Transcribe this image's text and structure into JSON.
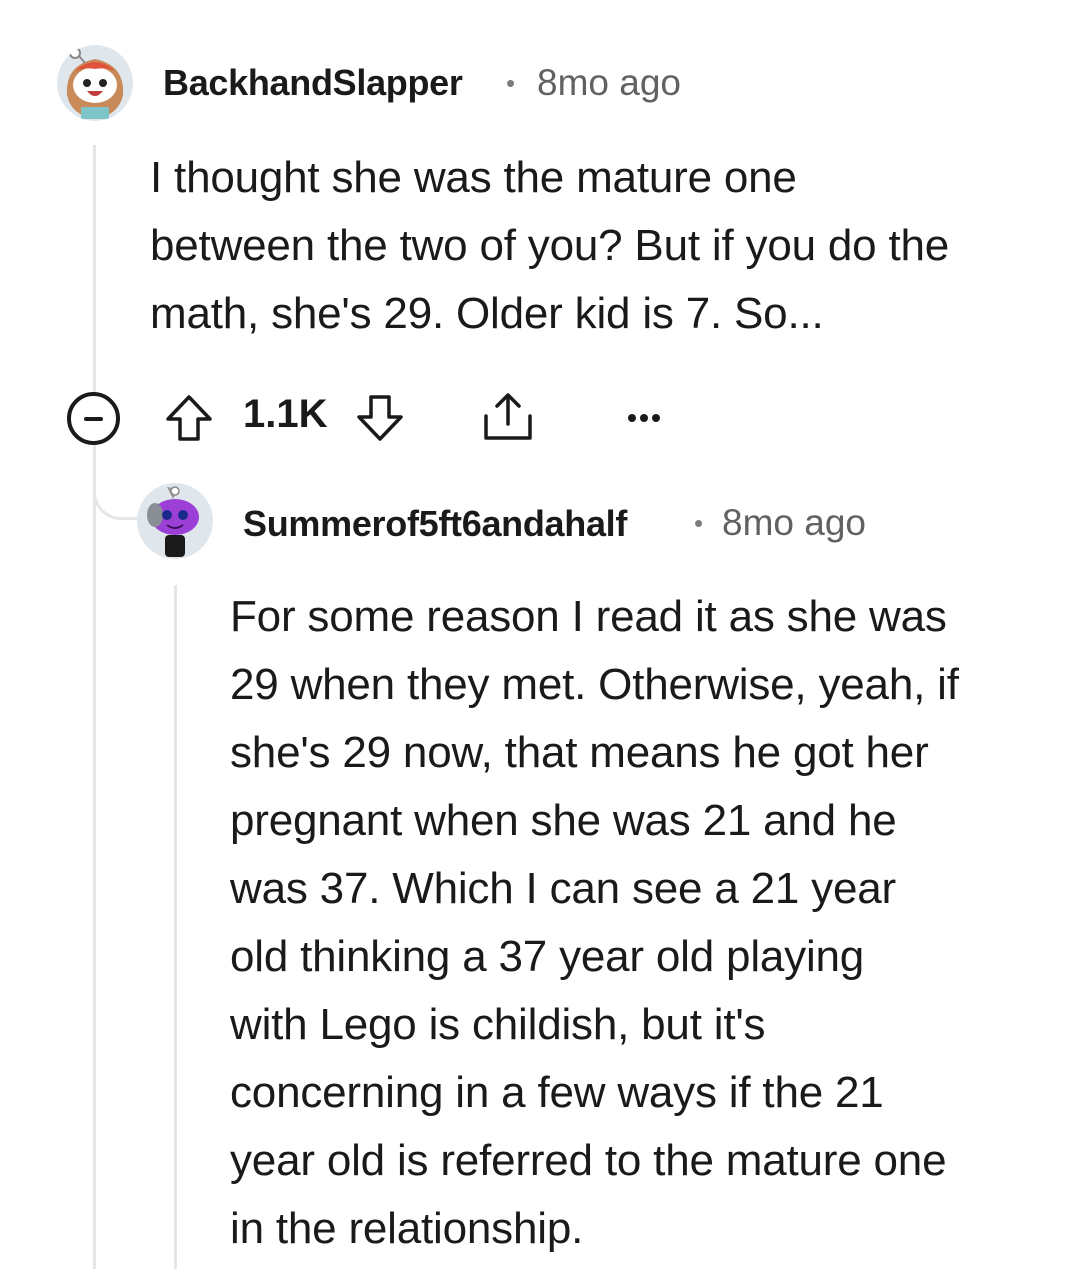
{
  "comments": [
    {
      "username": "BackhandSlapper",
      "separator": "•",
      "timestamp": "8mo ago",
      "avatar_icon": "snoo-avatar-icon",
      "body_lines": [
        "I thought she was the mature one",
        "between the two of you? But if you do the",
        "math, she's 29. Older kid is 7. So..."
      ],
      "actions": {
        "score": "1.1K",
        "collapse_icon": "collapse-icon",
        "upvote_icon": "upvote-arrow-icon",
        "downvote_icon": "downvote-arrow-icon",
        "share_icon": "share-icon",
        "more_icon": "more-options-icon"
      }
    },
    {
      "username": "Summerof5ft6andahalf",
      "separator": "•",
      "timestamp": "8mo ago",
      "avatar_icon": "snoo-avatar-icon",
      "body_lines": [
        "For some reason I read it as she was",
        "29 when they met. Otherwise, yeah, if",
        "she's 29 now, that means he got her",
        "pregnant when she was 21 and he",
        "was 37. Which I can see a 21 year",
        "old thinking a 37 year old playing",
        "with Lego is childish, but it's",
        "concerning in a few ways if the 21",
        "year old is referred to the mature one",
        "in the relationship."
      ]
    }
  ],
  "colors": {
    "text": "#1a1a1b",
    "meta": "#5f6264",
    "thread_line": "#e4e6e8"
  }
}
